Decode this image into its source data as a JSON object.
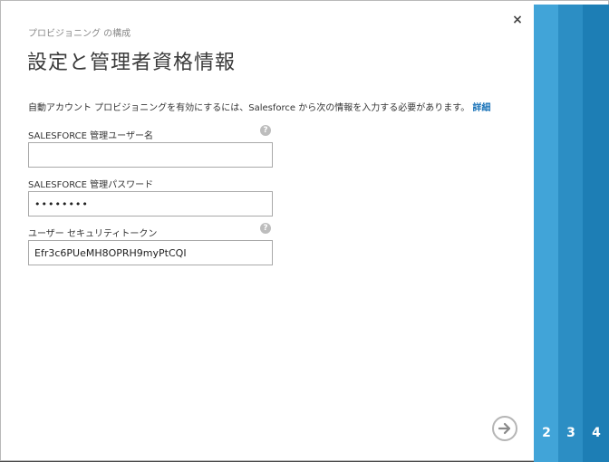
{
  "dialog": {
    "subtitle": "プロビジョニング の構成",
    "title": "設定と管理者資格情報",
    "close_glyph": "×",
    "description": "自動アカウント プロビジョニングを有効にするには、Salesforce から次の情報を入力する必要があります。",
    "details_link": "詳細"
  },
  "fields": {
    "username": {
      "label": "SALESFORCE 管理ユーザー名",
      "value": "",
      "help": "?"
    },
    "password": {
      "label": "SALESFORCE 管理パスワード",
      "value": "••••••••"
    },
    "token": {
      "label": "ユーザー セキュリティトークン",
      "value": "Efr3c6PUeMH8OPRH9myPtCQI",
      "help": "?"
    }
  },
  "steps": [
    {
      "number": "2",
      "color": "#41a4d8"
    },
    {
      "number": "3",
      "color": "#2c8ec4"
    },
    {
      "number": "4",
      "color": "#1d7eb5"
    }
  ],
  "navigation": {
    "next_icon": "arrow-right-icon"
  }
}
